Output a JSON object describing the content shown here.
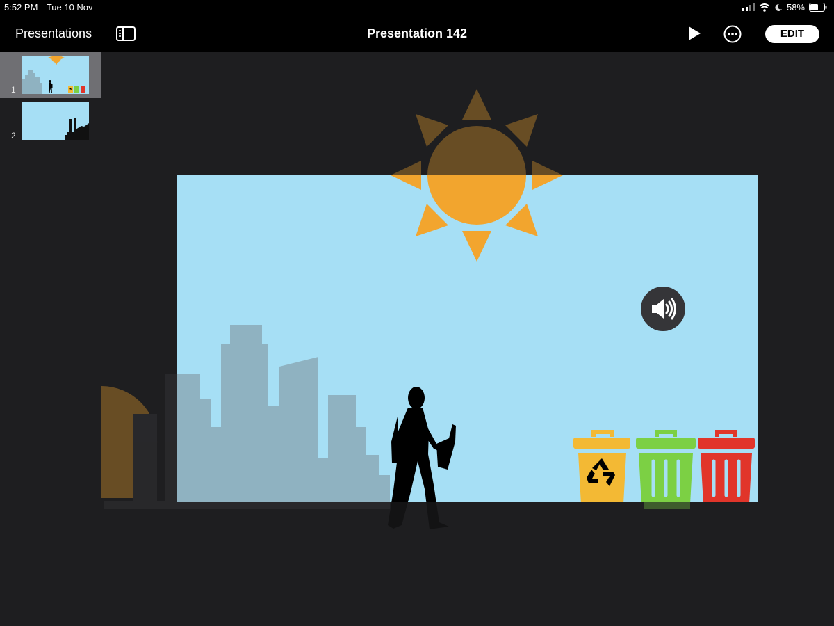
{
  "status_bar": {
    "time": "5:52 PM",
    "date": "Tue 10 Nov",
    "battery_percent": "58%",
    "battery_level": 0.58,
    "icons": [
      "cellular-signal-icon",
      "wifi-icon",
      "do-not-disturb-moon-icon",
      "battery-icon"
    ]
  },
  "nav": {
    "back_label": "Presentations",
    "title": "Presentation 142",
    "edit_label": "EDIT",
    "icons": [
      "sidebar-toggle-icon",
      "play-icon",
      "more-options-icon"
    ]
  },
  "slides": [
    {
      "number": "1",
      "selected": true
    },
    {
      "number": "2",
      "selected": false
    }
  ],
  "slide_content": {
    "background_color": "#a6dff5",
    "sun_color": "#f2a52e",
    "skyline_color": "#8fb2c1",
    "bin_colors": [
      "#f3b934",
      "#7cd044",
      "#e1352a"
    ],
    "icons": [
      "sun-icon",
      "city-skyline",
      "man-with-bottle-silhouette",
      "recycle-icon",
      "speaker-icon"
    ]
  }
}
